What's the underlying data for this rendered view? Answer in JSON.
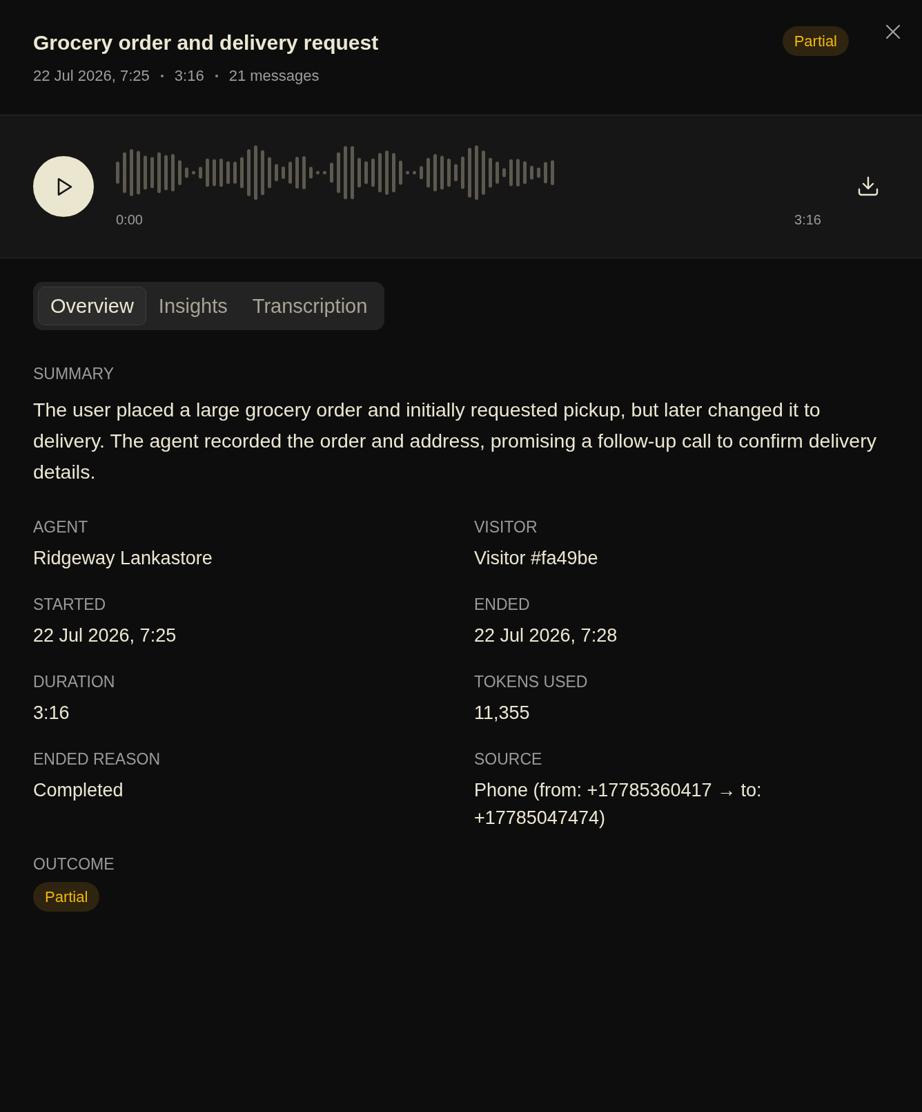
{
  "header": {
    "title": "Grocery order and delivery request",
    "meta": [
      "22 Jul 2026, 7:25",
      "3:16",
      "21 messages"
    ],
    "status": "Partial"
  },
  "player": {
    "current_time": "0:00",
    "total_time": "3:16"
  },
  "tabs": [
    {
      "label": "Overview",
      "selected": true
    },
    {
      "label": "Insights",
      "selected": false
    },
    {
      "label": "Transcription",
      "selected": false
    }
  ],
  "summary": {
    "label": "SUMMARY",
    "text": "The user placed a large grocery order and initially requested pickup, but later changed it to delivery. The agent recorded the order and address, promising a follow-up call to confirm delivery details."
  },
  "details": [
    {
      "kind": "text",
      "label": "AGENT",
      "value": "Ridgeway Lankastore"
    },
    {
      "kind": "text",
      "label": "VISITOR",
      "value": "Visitor #fa49be"
    },
    {
      "kind": "text",
      "label": "STARTED",
      "value": "22 Jul 2026, 7:25"
    },
    {
      "kind": "text",
      "label": "ENDED",
      "value": "22 Jul 2026, 7:28"
    },
    {
      "kind": "text",
      "label": "DURATION",
      "value": "3:16"
    },
    {
      "kind": "text",
      "label": "TOKENS USED",
      "value": "11,355"
    },
    {
      "kind": "text",
      "label": "ENDED REASON",
      "value": "Completed"
    },
    {
      "kind": "text",
      "label": "SOURCE",
      "value": "Phone (from: +17785360417 → to: +17785047474)"
    },
    {
      "kind": "badge",
      "label": "OUTCOME",
      "value": "Partial"
    }
  ]
}
